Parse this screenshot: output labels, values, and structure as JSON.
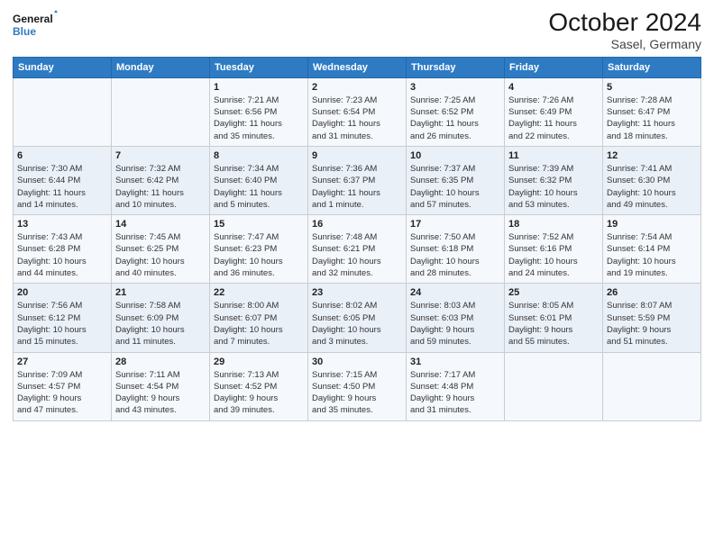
{
  "logo": {
    "line1": "General",
    "line2": "Blue"
  },
  "title": "October 2024",
  "subtitle": "Sasel, Germany",
  "days_header": [
    "Sunday",
    "Monday",
    "Tuesday",
    "Wednesday",
    "Thursday",
    "Friday",
    "Saturday"
  ],
  "weeks": [
    [
      {
        "day": "",
        "info": ""
      },
      {
        "day": "",
        "info": ""
      },
      {
        "day": "1",
        "info": "Sunrise: 7:21 AM\nSunset: 6:56 PM\nDaylight: 11 hours\nand 35 minutes."
      },
      {
        "day": "2",
        "info": "Sunrise: 7:23 AM\nSunset: 6:54 PM\nDaylight: 11 hours\nand 31 minutes."
      },
      {
        "day": "3",
        "info": "Sunrise: 7:25 AM\nSunset: 6:52 PM\nDaylight: 11 hours\nand 26 minutes."
      },
      {
        "day": "4",
        "info": "Sunrise: 7:26 AM\nSunset: 6:49 PM\nDaylight: 11 hours\nand 22 minutes."
      },
      {
        "day": "5",
        "info": "Sunrise: 7:28 AM\nSunset: 6:47 PM\nDaylight: 11 hours\nand 18 minutes."
      }
    ],
    [
      {
        "day": "6",
        "info": "Sunrise: 7:30 AM\nSunset: 6:44 PM\nDaylight: 11 hours\nand 14 minutes."
      },
      {
        "day": "7",
        "info": "Sunrise: 7:32 AM\nSunset: 6:42 PM\nDaylight: 11 hours\nand 10 minutes."
      },
      {
        "day": "8",
        "info": "Sunrise: 7:34 AM\nSunset: 6:40 PM\nDaylight: 11 hours\nand 5 minutes."
      },
      {
        "day": "9",
        "info": "Sunrise: 7:36 AM\nSunset: 6:37 PM\nDaylight: 11 hours\nand 1 minute."
      },
      {
        "day": "10",
        "info": "Sunrise: 7:37 AM\nSunset: 6:35 PM\nDaylight: 10 hours\nand 57 minutes."
      },
      {
        "day": "11",
        "info": "Sunrise: 7:39 AM\nSunset: 6:32 PM\nDaylight: 10 hours\nand 53 minutes."
      },
      {
        "day": "12",
        "info": "Sunrise: 7:41 AM\nSunset: 6:30 PM\nDaylight: 10 hours\nand 49 minutes."
      }
    ],
    [
      {
        "day": "13",
        "info": "Sunrise: 7:43 AM\nSunset: 6:28 PM\nDaylight: 10 hours\nand 44 minutes."
      },
      {
        "day": "14",
        "info": "Sunrise: 7:45 AM\nSunset: 6:25 PM\nDaylight: 10 hours\nand 40 minutes."
      },
      {
        "day": "15",
        "info": "Sunrise: 7:47 AM\nSunset: 6:23 PM\nDaylight: 10 hours\nand 36 minutes."
      },
      {
        "day": "16",
        "info": "Sunrise: 7:48 AM\nSunset: 6:21 PM\nDaylight: 10 hours\nand 32 minutes."
      },
      {
        "day": "17",
        "info": "Sunrise: 7:50 AM\nSunset: 6:18 PM\nDaylight: 10 hours\nand 28 minutes."
      },
      {
        "day": "18",
        "info": "Sunrise: 7:52 AM\nSunset: 6:16 PM\nDaylight: 10 hours\nand 24 minutes."
      },
      {
        "day": "19",
        "info": "Sunrise: 7:54 AM\nSunset: 6:14 PM\nDaylight: 10 hours\nand 19 minutes."
      }
    ],
    [
      {
        "day": "20",
        "info": "Sunrise: 7:56 AM\nSunset: 6:12 PM\nDaylight: 10 hours\nand 15 minutes."
      },
      {
        "day": "21",
        "info": "Sunrise: 7:58 AM\nSunset: 6:09 PM\nDaylight: 10 hours\nand 11 minutes."
      },
      {
        "day": "22",
        "info": "Sunrise: 8:00 AM\nSunset: 6:07 PM\nDaylight: 10 hours\nand 7 minutes."
      },
      {
        "day": "23",
        "info": "Sunrise: 8:02 AM\nSunset: 6:05 PM\nDaylight: 10 hours\nand 3 minutes."
      },
      {
        "day": "24",
        "info": "Sunrise: 8:03 AM\nSunset: 6:03 PM\nDaylight: 9 hours\nand 59 minutes."
      },
      {
        "day": "25",
        "info": "Sunrise: 8:05 AM\nSunset: 6:01 PM\nDaylight: 9 hours\nand 55 minutes."
      },
      {
        "day": "26",
        "info": "Sunrise: 8:07 AM\nSunset: 5:59 PM\nDaylight: 9 hours\nand 51 minutes."
      }
    ],
    [
      {
        "day": "27",
        "info": "Sunrise: 7:09 AM\nSunset: 4:57 PM\nDaylight: 9 hours\nand 47 minutes."
      },
      {
        "day": "28",
        "info": "Sunrise: 7:11 AM\nSunset: 4:54 PM\nDaylight: 9 hours\nand 43 minutes."
      },
      {
        "day": "29",
        "info": "Sunrise: 7:13 AM\nSunset: 4:52 PM\nDaylight: 9 hours\nand 39 minutes."
      },
      {
        "day": "30",
        "info": "Sunrise: 7:15 AM\nSunset: 4:50 PM\nDaylight: 9 hours\nand 35 minutes."
      },
      {
        "day": "31",
        "info": "Sunrise: 7:17 AM\nSunset: 4:48 PM\nDaylight: 9 hours\nand 31 minutes."
      },
      {
        "day": "",
        "info": ""
      },
      {
        "day": "",
        "info": ""
      }
    ]
  ]
}
